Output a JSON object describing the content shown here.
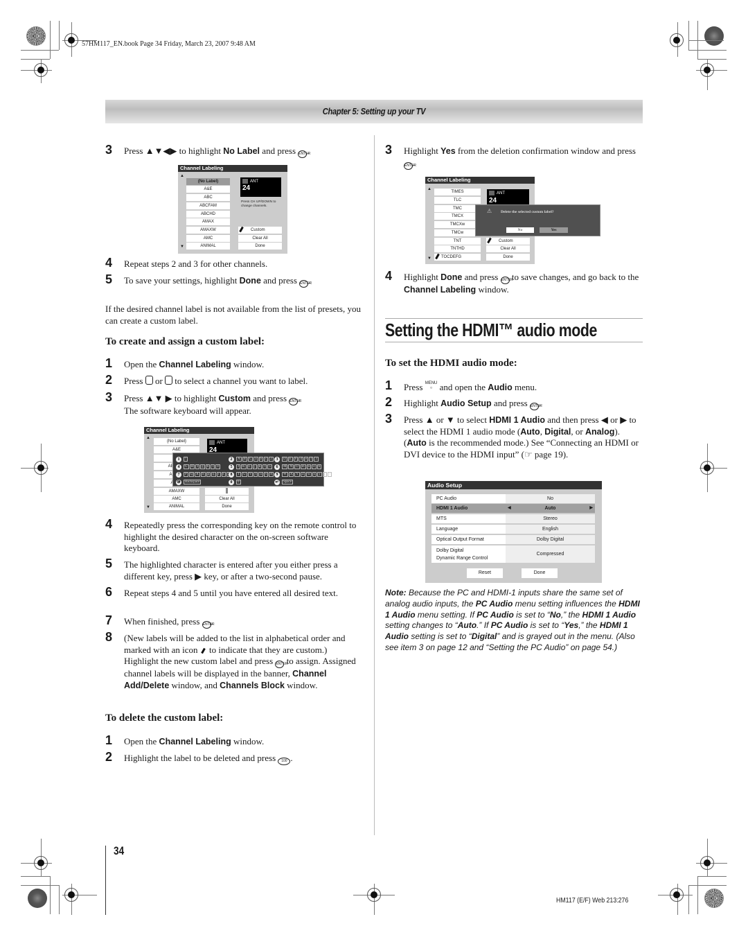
{
  "header": {
    "book_line": "57HM117_EN.book  Page 34  Friday, March 23, 2007  9:48 AM",
    "chapter": "Chapter 5: Setting up your TV"
  },
  "left": {
    "step3": {
      "num": "3",
      "pre": "Press ▲▼◀▶ to highlight ",
      "bold": "No Label",
      "post": " and press ",
      "btn": "ENTER",
      "end": "."
    },
    "osd1": {
      "title": "Channel Labeling",
      "list": [
        "(No Label)",
        "A&E",
        "ABC",
        "ABCFAM",
        "ABCHD",
        "AMAX",
        "AMAXW",
        "AMC",
        "ANIMAL"
      ],
      "selected_index": 0,
      "ant_label": "ANT",
      "channel": "24",
      "hint": "Press CH UP/DOWN to change channels.",
      "buttons": [
        "Custom",
        "Clear All",
        "Done"
      ]
    },
    "step4": {
      "num": "4",
      "text": "Repeat steps 2 and 3 for other channels."
    },
    "step5": {
      "num": "5",
      "pre": "To save your settings, highlight ",
      "bold": "Done",
      "post": " and press ",
      "btn": "ENTER",
      "end": "."
    },
    "para": "If the desired channel label is not available from the list of presets, you can create a custom label.",
    "sub1": "To create and assign a custom label:",
    "c1": {
      "num": "1",
      "pre": "Open the ",
      "bold": "Channel Labeling",
      "post": " window."
    },
    "c2": {
      "num": "2",
      "pre": "Press ",
      "btn1": "CH▲",
      "mid": " or ",
      "btn2": "CH▼",
      "post": " to select a channel you want to label."
    },
    "c3": {
      "num": "3",
      "pre": "Press ▲▼ ▶ to highlight ",
      "bold": "Custom",
      "post": " and press ",
      "btn": "ENTER",
      "end": ".",
      "line2": "The software keyboard will appear."
    },
    "osd2": {
      "title": "Channel Labeling",
      "list": [
        "{No Label}",
        "A&E",
        "ABC",
        "ABCFAM",
        "ABCHD",
        "AMAX",
        "AMAXW",
        "AMC",
        "ANIMAL"
      ],
      "ant_label": "ANT",
      "channel": "24",
      "buttons": [
        "Custom",
        "Clear All",
        "Done"
      ],
      "keyboard": [
        {
          "key": "1",
          "chars": [
            "!"
          ]
        },
        {
          "key": "2",
          "chars": [
            "A",
            "B",
            "C",
            "a",
            "b",
            "c",
            "2"
          ]
        },
        {
          "key": "3",
          "chars": [
            "D",
            "E",
            "F",
            "d",
            "e",
            "f",
            "3"
          ]
        },
        {
          "key": "4",
          "chars": [
            "G",
            "H",
            "I",
            "g",
            "h",
            "i",
            "4"
          ]
        },
        {
          "key": "5",
          "chars": [
            "J",
            "K",
            "L",
            "j",
            "k",
            "l",
            "5"
          ]
        },
        {
          "key": "6",
          "chars": [
            "M",
            "N",
            "O",
            "m",
            "n",
            "o",
            "6"
          ]
        },
        {
          "key": "7",
          "chars": [
            "P",
            "Q",
            "R",
            "S",
            "p",
            "q",
            "r",
            "s",
            "7"
          ]
        },
        {
          "key": "8",
          "chars": [
            "T",
            "U",
            "V",
            "t",
            "u",
            "v",
            "8"
          ]
        },
        {
          "key": "9",
          "chars": [
            "W",
            "X",
            "Y",
            "Z",
            "w",
            "x",
            "y",
            "z",
            "9"
          ]
        },
        {
          "key": "100",
          "chars": [
            "Backspace"
          ]
        },
        {
          "key": "0",
          "chars": [
            "0"
          ]
        },
        {
          "key": "ENT",
          "chars": [
            "Space"
          ]
        }
      ]
    },
    "s4": {
      "num": "4",
      "text": "Repeatedly press the corresponding key on the remote control to highlight the desired character on the on-screen software keyboard."
    },
    "s5": {
      "num": "5",
      "text": "The highlighted character is entered after you either press a different key, press ▶ key, or after a two-second pause."
    },
    "s6": {
      "num": "6",
      "text": "Repeat steps 4 and 5 until you have entered all desired text."
    },
    "s7": {
      "num": "7",
      "pre": "When finished, press ",
      "btn": "ENTER",
      "end": "."
    },
    "s8": {
      "num": "8",
      "t1": "(New labels will be added to the list in alphabetical order and marked with an icon ",
      "t2": " to indicate that they are custom.) Highlight the new custom label and press ",
      "btn": "ENTER",
      "t3": " to assign. Assigned channel labels will be displayed in the banner, ",
      "b1": "Channel Add/Delete",
      "t4": " window, and ",
      "b2": "Channels Block",
      "t5": " window."
    },
    "sub2": "To delete the custom label:",
    "d1": {
      "num": "1",
      "pre": "Open the ",
      "bold": "Channel Labeling",
      "post": " window."
    },
    "d2": {
      "num": "2",
      "pre": "Highlight the label to be deleted and press ",
      "btn": "100",
      "end": "."
    },
    "page_number": "34"
  },
  "right": {
    "step3": {
      "num": "3",
      "pre": "Highlight ",
      "bold": "Yes",
      "post": " from the deletion confirmation window and press ",
      "btn": "ENTER",
      "end": "."
    },
    "osd3": {
      "title": "Channel Labeling",
      "list": [
        "TIMES",
        "TLC",
        "TMC",
        "TMCX",
        "TMCXw",
        "TMCw",
        "TNT",
        "TNTHD",
        "TOCDEFG"
      ],
      "ant_label": "ANT",
      "channel": "24",
      "buttons": [
        "Custom",
        "Clear All",
        "Done"
      ],
      "dialog_msg": "Delete the selected custom label?",
      "dialog_no": "No",
      "dialog_yes": "Yes"
    },
    "step4": {
      "num": "4",
      "pre": "Highlight ",
      "bold": "Done",
      "post": " and press ",
      "btn": "ENTER",
      "mid": " to save changes, and go back to the ",
      "bold2": "Channel Labeling",
      "end": " window."
    },
    "heading": "Setting the HDMI™ audio mode",
    "sub": "To set the HDMI audio mode:",
    "h1": {
      "num": "1",
      "pre": "Press ",
      "btn": "MENU",
      "mid": " and open the ",
      "bold": "Audio",
      "post": " menu."
    },
    "h2": {
      "num": "2",
      "pre": "Highlight ",
      "bold": "Audio Setup",
      "post": " and press ",
      "btn": "ENTER",
      "end": "."
    },
    "h3": {
      "num": "3",
      "t1": "Press ▲ or ▼ to select ",
      "b1": "HDMI 1 Audio",
      "t2": " and then press ◀ or ▶ to select the HDMI 1 audio mode (",
      "b2": "Auto",
      "t3": ", ",
      "b3": "Digital",
      "t4": ", or ",
      "b4": "Analog",
      "t5": "). (",
      "b5": "Auto",
      "t6": " is the recommended mode.) See “Connecting an HDMI or DVI device to the HDMI input” (☞ page 19)."
    },
    "audio_setup": {
      "title": "Audio Setup",
      "rows": [
        {
          "label": "PC Audio",
          "value": "No"
        },
        {
          "label": "HDMI 1 Audio",
          "value": "Auto",
          "selected": true
        },
        {
          "label": "MTS",
          "value": "Stereo"
        },
        {
          "label": "Language",
          "value": "English"
        },
        {
          "label": "Optical Output Format",
          "value": "Dolby Digital"
        },
        {
          "label": "Dolby Digital Dynamic Range Control",
          "value": "Compressed"
        }
      ],
      "label_line1": "Dolby Digital",
      "label_line2": "Dynamic Range Control",
      "reset": "Reset",
      "done": "Done"
    },
    "note": {
      "lead": "Note:",
      "t1": " Because the PC and HDMI-1 inputs share the same set of analog audio inputs, the ",
      "b1": "PC Audio",
      "t2": " menu setting influences the ",
      "b2": "HDMI 1 Audio",
      "t3": " menu setting. If ",
      "b3": "PC Audio",
      "t4": " is set to “",
      "b4": "No",
      "t5": ",” the ",
      "b5": "HDMI 1 Audio",
      "t6": " setting changes to “",
      "b6": "Auto",
      "t7": ".” If ",
      "b7": "PC Audio",
      "t8": " is set to “",
      "b8": "Yes",
      "t9": ",” the ",
      "b9": "HDMI 1 Audio",
      "t10": " setting is set to “",
      "b10": "Digital",
      "t11": "” and is grayed out in the menu. (Also see item 3 on page 12 and “Setting the PC Audio” on page 54.)"
    }
  },
  "footer": {
    "code": "HM117 (E/F) Web 213:276"
  }
}
